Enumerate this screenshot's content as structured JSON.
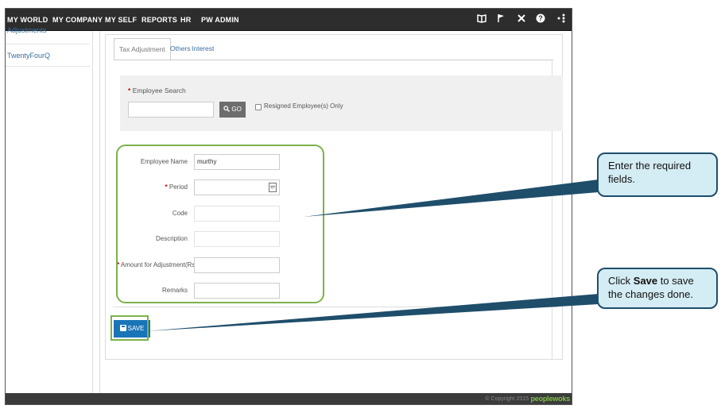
{
  "nav": {
    "items": [
      "MY WORLD",
      "MY COMPANY",
      "MY SELF",
      "REPORTS",
      "HR",
      "PW ADMIN"
    ],
    "icons": [
      "book-icon",
      "flag-icon",
      "tools-icon",
      "help-icon",
      "share-icon"
    ]
  },
  "sidebar": {
    "items": [
      "Adjustments",
      "TwentyFourQ"
    ]
  },
  "tabs": [
    {
      "label": "Tax Adjustment",
      "active": true
    },
    {
      "label": "Others",
      "active": false
    },
    {
      "label": "Interest",
      "active": false
    }
  ],
  "search": {
    "label": "Employee Search",
    "input_value": "",
    "go_label": "GO",
    "resigned_label": "Resigned Employee(s) Only"
  },
  "form": {
    "employee_name_label": "Employee Name",
    "employee_name_value": "murthy",
    "period_label": "Period",
    "code_label": "Code",
    "description_label": "Description",
    "amount_label": "Amount for Adjustment(Rs.)",
    "remarks_label": "Remarks"
  },
  "save_label": "SAVE",
  "footer": {
    "copyright": "© Copyright 2015",
    "brand": "peoplewoks"
  },
  "callouts": {
    "required_fields": "Enter the required fields.",
    "save_prefix": "Click ",
    "save_bold": "Save",
    "save_suffix": " to save the changes done."
  },
  "colors": {
    "nav_bg": "#2d2d2d",
    "accent_blue": "#1a74b8",
    "highlight_green": "#7bb34b",
    "callout_bg": "#d4ecf4",
    "callout_border": "#1f4e6b",
    "brand_green": "#7ec242"
  }
}
